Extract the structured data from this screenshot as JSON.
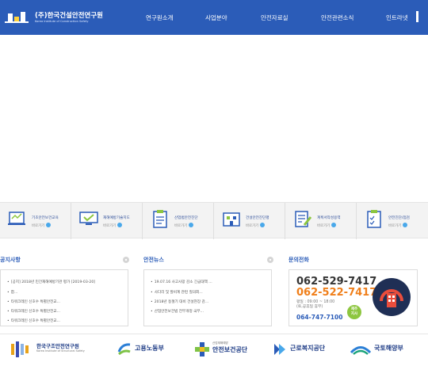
{
  "header": {
    "org_name": "(주)한국건설안전연구원",
    "org_name_en": "Korea Institute of Construction Safety",
    "nav": [
      "연구원소개",
      "사업분야",
      "안전자료실",
      "안전관련소식",
      "인트라넷"
    ],
    "colors": {
      "header_bg": "#2b5cb8"
    }
  },
  "quick_links": [
    {
      "label": "기초안전보건교육",
      "go": "바로가기",
      "icon": "laptop-board-icon"
    },
    {
      "label": "재해예방기술지도",
      "go": "바로가기",
      "icon": "monitor-check-icon"
    },
    {
      "label": "산업법안전진단",
      "go": "바로가기",
      "icon": "clipboard-list-icon"
    },
    {
      "label": "건설안전진단평",
      "go": "바로가기",
      "icon": "building-icon"
    },
    {
      "label": "계획서작성용역",
      "go": "바로가기",
      "icon": "document-pen-icon"
    },
    {
      "label": "안전진단/점검",
      "go": "바로가기",
      "icon": "clipboard-check-icon"
    }
  ],
  "notice": {
    "title": "공지사항",
    "items": [
      "[공지] 2018년 민간재해예방기관 평가  [2019-03-20]",
      "합...",
      "타워크레인 신호수 특별안전교...",
      "타워크레인 신호수 특별안전교...",
      "타워크레인 신호수 특별안전교..."
    ]
  },
  "news": {
    "title": "안전뉴스",
    "items": [
      "19.07.16 사고사망 감소 긴급대책 ...",
      "사다리 및 발비계 관련 질의회...",
      "2018년 동절기 대비 건설현장 감...",
      "산업안전보건법 전부개정 국무..."
    ]
  },
  "contact": {
    "title": "문의전화",
    "phone_main": "062-529-7417",
    "phone_sub": "062-522-7417",
    "hours": "평일 : 09:00 ~ 18:00",
    "holiday": "(토,공휴일 휴무)",
    "phone_extra": "064-747-7100",
    "badge": "제주\n지사",
    "colors": {
      "orange": "#f07f1a",
      "green": "#8dc63f",
      "navy": "#1f2f55"
    }
  },
  "partners": [
    {
      "name": "한국구조안전연구원",
      "sub": "Korea Institute of Structural Safety",
      "icon": "kiss-logo-icon"
    },
    {
      "name": "고용노동부",
      "icon": "moel-logo-icon"
    },
    {
      "name": "안전보건공단",
      "sub": "산업재해예방",
      "icon": "kosha-logo-icon"
    },
    {
      "name": "근로복지공단",
      "icon": "comwel-logo-icon"
    },
    {
      "name": "국토해양부",
      "icon": "molit-logo-icon"
    }
  ]
}
